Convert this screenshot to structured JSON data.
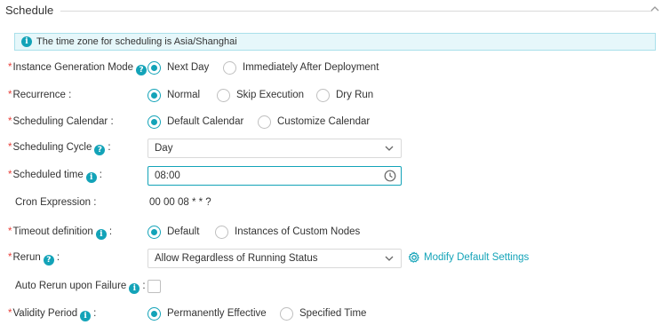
{
  "section": {
    "title": "Schedule"
  },
  "notice": {
    "text": "The time zone for scheduling is Asia/Shanghai"
  },
  "instance_generation": {
    "label": "Instance Generation Mode",
    "options": [
      {
        "label": "Next Day",
        "selected": true
      },
      {
        "label": "Immediately After Deployment",
        "selected": false
      }
    ]
  },
  "recurrence": {
    "label": "Recurrence :",
    "options": [
      {
        "label": "Normal",
        "selected": true
      },
      {
        "label": "Skip Execution",
        "selected": false
      },
      {
        "label": "Dry Run",
        "selected": false
      }
    ]
  },
  "scheduling_calendar": {
    "label": "Scheduling Calendar :",
    "options": [
      {
        "label": "Default Calendar",
        "selected": true
      },
      {
        "label": "Customize Calendar",
        "selected": false
      }
    ]
  },
  "scheduling_cycle": {
    "label": "Scheduling Cycle",
    "colon": ":",
    "value": "Day"
  },
  "scheduled_time": {
    "label": "Scheduled time",
    "colon": ":",
    "value": "08:00"
  },
  "cron_expression": {
    "label": "Cron Expression :",
    "value": "00 00 08 * * ?"
  },
  "timeout_definition": {
    "label": "Timeout definition",
    "colon": ":",
    "options": [
      {
        "label": "Default",
        "selected": true
      },
      {
        "label": "Instances of Custom Nodes",
        "selected": false
      }
    ]
  },
  "rerun": {
    "label": "Rerun",
    "colon": ":",
    "value": "Allow Regardless of Running Status",
    "link": "Modify Default Settings"
  },
  "auto_rerun": {
    "label": "Auto Rerun upon Failure",
    "colon": ":",
    "checked": false
  },
  "validity_period": {
    "label": "Validity Period",
    "colon": ":",
    "options": [
      {
        "label": "Permanently Effective",
        "selected": true
      },
      {
        "label": "Specified Time",
        "selected": false
      }
    ]
  },
  "colors": {
    "accent": "#13a3b8",
    "required": "#e8413b",
    "notice_bg": "#e6f7fa"
  }
}
